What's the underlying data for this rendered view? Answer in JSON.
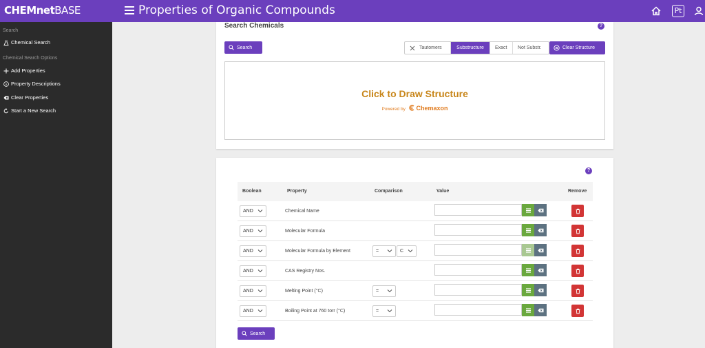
{
  "header": {
    "logo_prefix": "CHEMnet",
    "logo_suffix": "BASE",
    "title": "Properties of Organic Compounds",
    "icons": [
      "home-icon",
      "periodic-table-icon",
      "user-icon"
    ],
    "pt_label": "Pt"
  },
  "sidebar": {
    "section_search": "Search",
    "chemical_search": "Chemical Search",
    "section_options": "Chemical Search Options",
    "items": [
      {
        "label": "Add Properties",
        "icon": "plus-icon"
      },
      {
        "label": "Property Descriptions",
        "icon": "info-icon"
      },
      {
        "label": "Clear Properties",
        "icon": "backspace-icon"
      },
      {
        "label": "Start a New Search",
        "icon": "refresh-icon"
      }
    ]
  },
  "search_card": {
    "title": "Search Chemicals",
    "search_label": "Search",
    "options": [
      "Tautomers",
      "Substructure",
      "Exact",
      "Not Substr."
    ],
    "active_option": "Substructure",
    "clear_label": "Clear Structure",
    "draw_label": "Click to Draw Structure",
    "powered_by": "Powered by",
    "powered_brand": "Chemaxon"
  },
  "properties_card": {
    "columns": {
      "boolean": "Boolean",
      "property": "Property",
      "comparison": "Comparison",
      "value": "Value",
      "remove": "Remove"
    },
    "rows": [
      {
        "boolean": "AND",
        "property": "Chemical Name",
        "comparison": "",
        "extra": "",
        "list_dim": false
      },
      {
        "boolean": "AND",
        "property": "Molecular Formula",
        "comparison": "",
        "extra": "",
        "list_dim": false
      },
      {
        "boolean": "AND",
        "property": "Molecular Formula by Element",
        "comparison": "=",
        "extra": "C",
        "list_dim": true
      },
      {
        "boolean": "AND",
        "property": "CAS Registry Nos.",
        "comparison": "",
        "extra": "",
        "list_dim": false
      },
      {
        "boolean": "AND",
        "property": "Melting Point (°C)",
        "comparison": "=",
        "extra": "",
        "list_dim": false
      },
      {
        "boolean": "AND",
        "property": "Boiling Point at 760 torr (°C)",
        "comparison": "=",
        "extra": "",
        "list_dim": false
      }
    ],
    "search_label": "Search"
  },
  "colors": {
    "brand": "#6b3fbd",
    "sidebar": "#2b2b2b",
    "list_button": "#6aa83e",
    "clear_button": "#5d7281",
    "remove_button": "#d23535",
    "draw_text": "#c8861a"
  }
}
